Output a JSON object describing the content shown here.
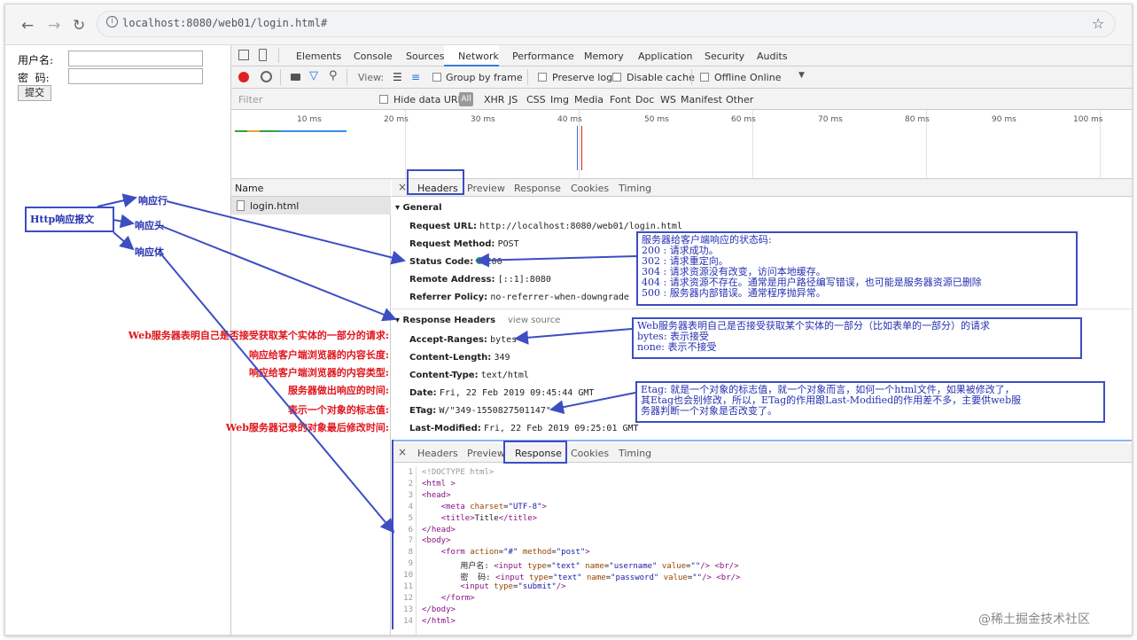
{
  "browser": {
    "url": "localhost:8080/web01/login.html#",
    "icons": [
      "back-icon",
      "forward-icon",
      "reload-icon",
      "info-icon",
      "star-icon"
    ]
  },
  "page": {
    "username_label": "用户名:",
    "password_label": "密  码:",
    "submit_label": "提交"
  },
  "devtools": {
    "tabs": [
      "Elements",
      "Console",
      "Sources",
      "Network",
      "Performance",
      "Memory",
      "Application",
      "Security",
      "Audits"
    ],
    "toolbar": {
      "view_label": "View:",
      "group_by_frame": "Group by frame",
      "preserve_log": "Preserve log",
      "disable_cache": "Disable cache",
      "offline": "Offline",
      "online": "Online"
    },
    "filter": {
      "placeholder": "Filter",
      "hide_data_urls": "Hide data URLs",
      "types": [
        "All",
        "XHR",
        "JS",
        "CSS",
        "Img",
        "Media",
        "Font",
        "Doc",
        "WS",
        "Manifest",
        "Other"
      ]
    },
    "timeline_ticks": [
      "10 ms",
      "20 ms",
      "30 ms",
      "40 ms",
      "50 ms",
      "60 ms",
      "70 ms",
      "80 ms",
      "90 ms",
      "100 ms"
    ],
    "name_header": "Name",
    "request_name": "login.html",
    "detail_tabs": [
      "Headers",
      "Preview",
      "Response",
      "Cookies",
      "Timing"
    ],
    "general": {
      "title": "General",
      "request_url_label": "Request URL:",
      "request_url": "http://localhost:8080/web01/login.html",
      "request_method_label": "Request Method:",
      "request_method": "POST",
      "status_code_label": "Status Code:",
      "status_code": "200",
      "remote_address_label": "Remote Address:",
      "remote_address": "[::1]:8080",
      "referrer_policy_label": "Referrer Policy:",
      "referrer_policy": "no-referrer-when-downgrade"
    },
    "response_headers": {
      "title": "Response Headers",
      "view_source": "view source",
      "accept_ranges_label": "Accept-Ranges:",
      "accept_ranges": "bytes",
      "content_length_label": "Content-Length:",
      "content_length": "349",
      "content_type_label": "Content-Type:",
      "content_type": "text/html",
      "date_label": "Date:",
      "date": "Fri, 22 Feb 2019 09:45:44 GMT",
      "etag_label": "ETag:",
      "etag": "W/\"349-1550827501147\"",
      "last_modified_label": "Last-Modified:",
      "last_modified": "Fri, 22 Feb 2019 09:25:01 GMT"
    },
    "response_code": [
      "<!DOCTYPE html>",
      "<html >",
      "<head>",
      "    <meta charset=\"UTF-8\">",
      "    <title>Title</title>",
      "</head>",
      "<body>",
      "    <form action=\"#\" method=\"post\">",
      "        用户名: <input type=\"text\" name=\"username\" value=\"\"/> <br/>",
      "        密  码: <input type=\"text\" name=\"password\" value=\"\"/> <br/>",
      "        <input type=\"submit\"/>",
      "    </form>",
      "</body>",
      "</html>"
    ]
  },
  "annotations": {
    "http_message": "Http响应报文",
    "status_line": "响应行",
    "headers": "响应头",
    "body": "响应体",
    "status_note": [
      "服务器给客户端响应的状态码:",
      "200 : 请求成功。",
      "302 : 请求重定向。",
      "304 : 请求资源没有改变，访问本地缓存。",
      "404 : 请求资源不存在。通常是用户路径编写错误，也可能是服务器资源已删除",
      "500 : 服务器内部错误。通常程序抛异常。"
    ],
    "accept_ranges_note": [
      "Web服务器表明自己是否接受获取某个实体的一部分（比如表单的一部分）的请求",
      "bytes: 表示接受",
      "none: 表示不接受"
    ],
    "etag_note": [
      "Etag: 就是一个对象的标志值，就一个对象而言，如何一个html文件，如果被修改了，",
      "其Etag也会别修改，所以，ETag的作用跟Last-Modified的作用差不多，主要供web服",
      "务器判断一个对象是否改变了。"
    ],
    "red_labels": [
      "Web服务器表明自己是否接受获取某个实体的一部分的请求:",
      "响应给客户端浏览器的内容长度:",
      "响应给客户端浏览器的内容类型:",
      "服务器做出响应的时间:",
      "表示一个对象的标志值:",
      "Web服务器记录的对象最后修改时间:"
    ]
  },
  "watermark": "@稀土掘金技术社区",
  "colors": {
    "annotation_blue": "#3c4ec2",
    "annotation_red": "#e0151d",
    "status_green": "#1ea446",
    "record_red": "#e02020"
  }
}
